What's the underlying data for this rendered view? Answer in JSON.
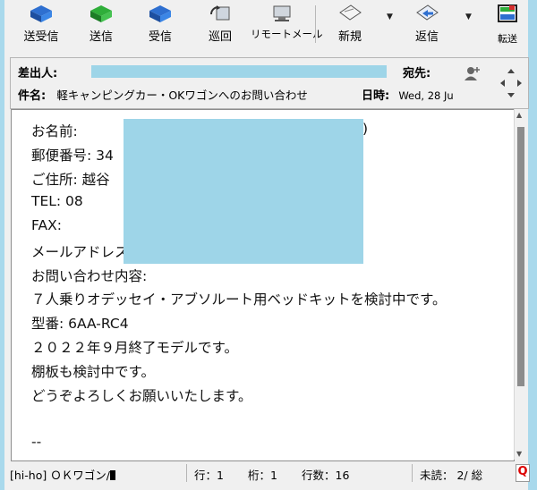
{
  "toolbar": {
    "send_receive": "送受信",
    "send": "送信",
    "receive": "受信",
    "patrol": "巡回",
    "remote_mail": "リモートメール",
    "new": "新規",
    "reply": "返信",
    "forward": "転送"
  },
  "header": {
    "from_label": "差出人:",
    "to_label": "宛先:",
    "subject_label": "件名:",
    "subject_value": "軽キャンピングカー・OKワゴンへのお問い合わせ",
    "date_label": "日時:",
    "date_value": "Wed, 28 Ju"
  },
  "body": {
    "lines": [
      "お名前:",
      "郵便番号: 34",
      "ご住所: 越谷",
      "TEL:        08",
      "FAX:",
      "メールアドレス:",
      "お問い合わせ内容:",
      "７人乗りオデッセイ・アブソルート用ベッドキットを検討中です。",
      "型番: 6AA-RC4",
      "２０２２年９月終了モデルです。",
      "棚板も検討中です。",
      "どうぞよろしくお願いいたします。",
      "",
      "--"
    ],
    "paren": ")"
  },
  "status": {
    "folder": "[hi-ho] ＯＫワゴン/",
    "line": "行：1",
    "col": "桁：1",
    "lines_count": "行数：16",
    "unread": "未読：  2/ 総",
    "q_icon": "Q"
  },
  "colors": {
    "redaction": "#9ed5e8",
    "background": "#a9d9ec"
  }
}
